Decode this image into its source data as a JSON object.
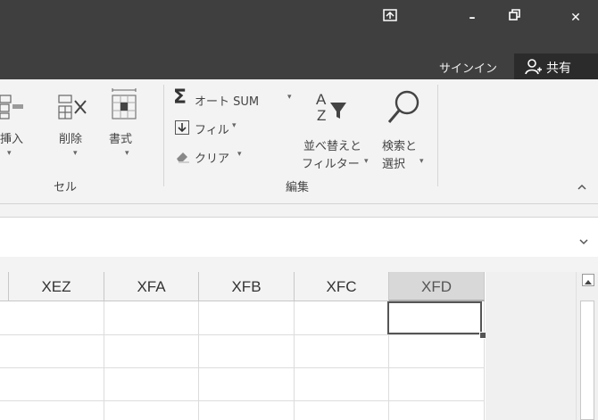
{
  "window": {
    "ribbon_display_options_label": "⧈",
    "minimize_label": "–",
    "restore_label": "❐",
    "close_label": "✕",
    "signin_label": "サインイン",
    "share_label": "共有"
  },
  "ribbon": {
    "cells_group": {
      "insert_label": "挿入",
      "delete_label": "削除",
      "format_label": "書式",
      "group_label": "セル"
    },
    "editing_group": {
      "autosum_label": "オート SUM",
      "fill_label": "フィル",
      "clear_label": "クリア",
      "sort_filter_label_line1": "並べ替えと",
      "sort_filter_label_line2": "フィルター",
      "find_select_label_line1": "検索と",
      "find_select_label_line2": "選択",
      "group_label": "編集"
    },
    "collapse_label": "^"
  },
  "formula_bar": {
    "expand_label": "⌄"
  },
  "sheet": {
    "columns": [
      "XEZ",
      "XFA",
      "XFB",
      "XFC",
      "XFD"
    ],
    "selected_column": "XFD"
  }
}
